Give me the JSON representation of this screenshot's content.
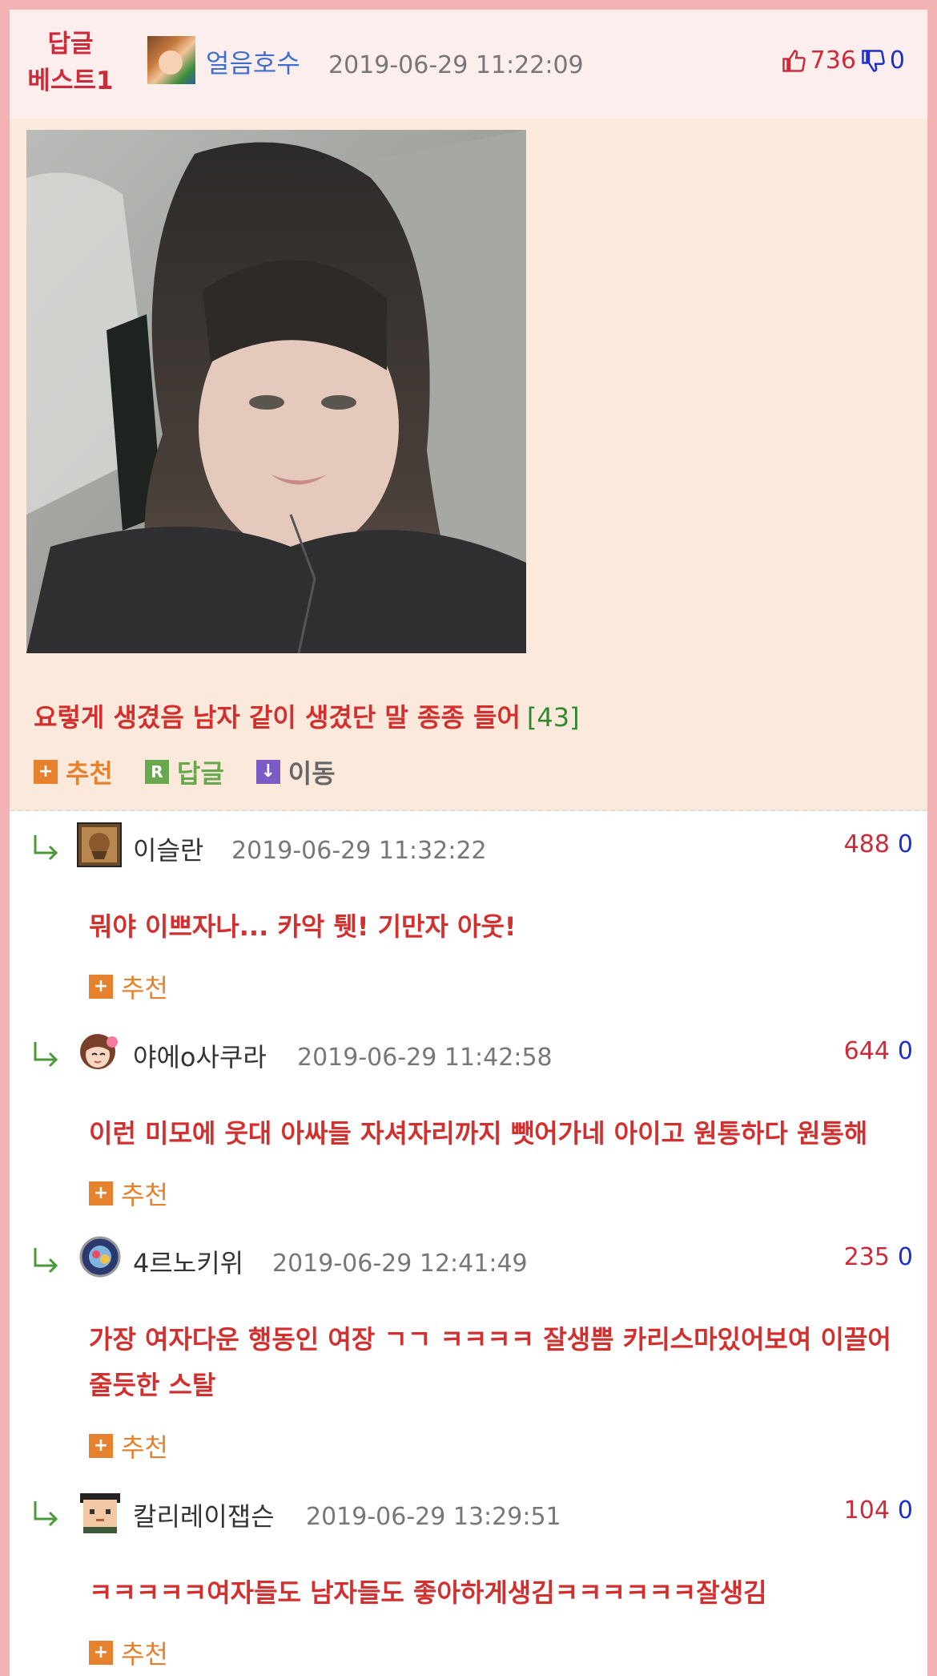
{
  "best": {
    "tag_line1": "답글",
    "tag_line2": "베스트1",
    "username": "얼음호수",
    "date": "2019-06-29 11:22:09",
    "up_votes": "736",
    "down_votes": "0",
    "text": "요렇게 생겼음 남자 같이 생겼단 말 종종 들어",
    "reply_count": "[43]",
    "actions": {
      "recommend": "추천",
      "reply": "답글",
      "move": "이동"
    },
    "icons": {
      "plus": "+",
      "reply": "R",
      "move": "↓"
    }
  },
  "comments": [
    {
      "username": "이슬란",
      "date": "2019-06-29 11:32:22",
      "up": "488",
      "down": "0",
      "text": "뭐야 이쁘자나... 카악 퉷! 기만자 아웃!",
      "recommend": "추천"
    },
    {
      "username": "야에o사쿠라",
      "date": "2019-06-29 11:42:58",
      "up": "644",
      "down": "0",
      "text": "이런 미모에 웃대 아싸들 자셔자리까지 뺏어가네 아이고 원통하다 원통해",
      "recommend": "추천"
    },
    {
      "username": "4르노키위",
      "date": "2019-06-29 12:41:49",
      "up": "235",
      "down": "0",
      "text": "가장 여자다운 행동인 여장 ㄱㄱ ㅋㅋㅋㅋ 잘생쁨 카리스마있어보여 이끌어줄듯한 스탈",
      "recommend": "추천"
    },
    {
      "username": "칼리레이잽슨",
      "date": "2019-06-29 13:29:51",
      "up": "104",
      "down": "0",
      "text": "ㅋㅋㅋㅋㅋ여자들도 남자들도 좋아하게생김ㅋㅋㅋㅋㅋㅋ잘생김",
      "recommend": "추천"
    }
  ],
  "colors": {
    "border": "#f3b2b4",
    "header_bg": "#fdeeee",
    "best_bg": "#fbe9dc",
    "red_text": "#d22f2f",
    "up_vote": "#cc2c3a",
    "down_vote": "#1d2fcc",
    "recommend": "#e6822d",
    "reply": "#6aa84f",
    "move": "#7b5cc4"
  }
}
